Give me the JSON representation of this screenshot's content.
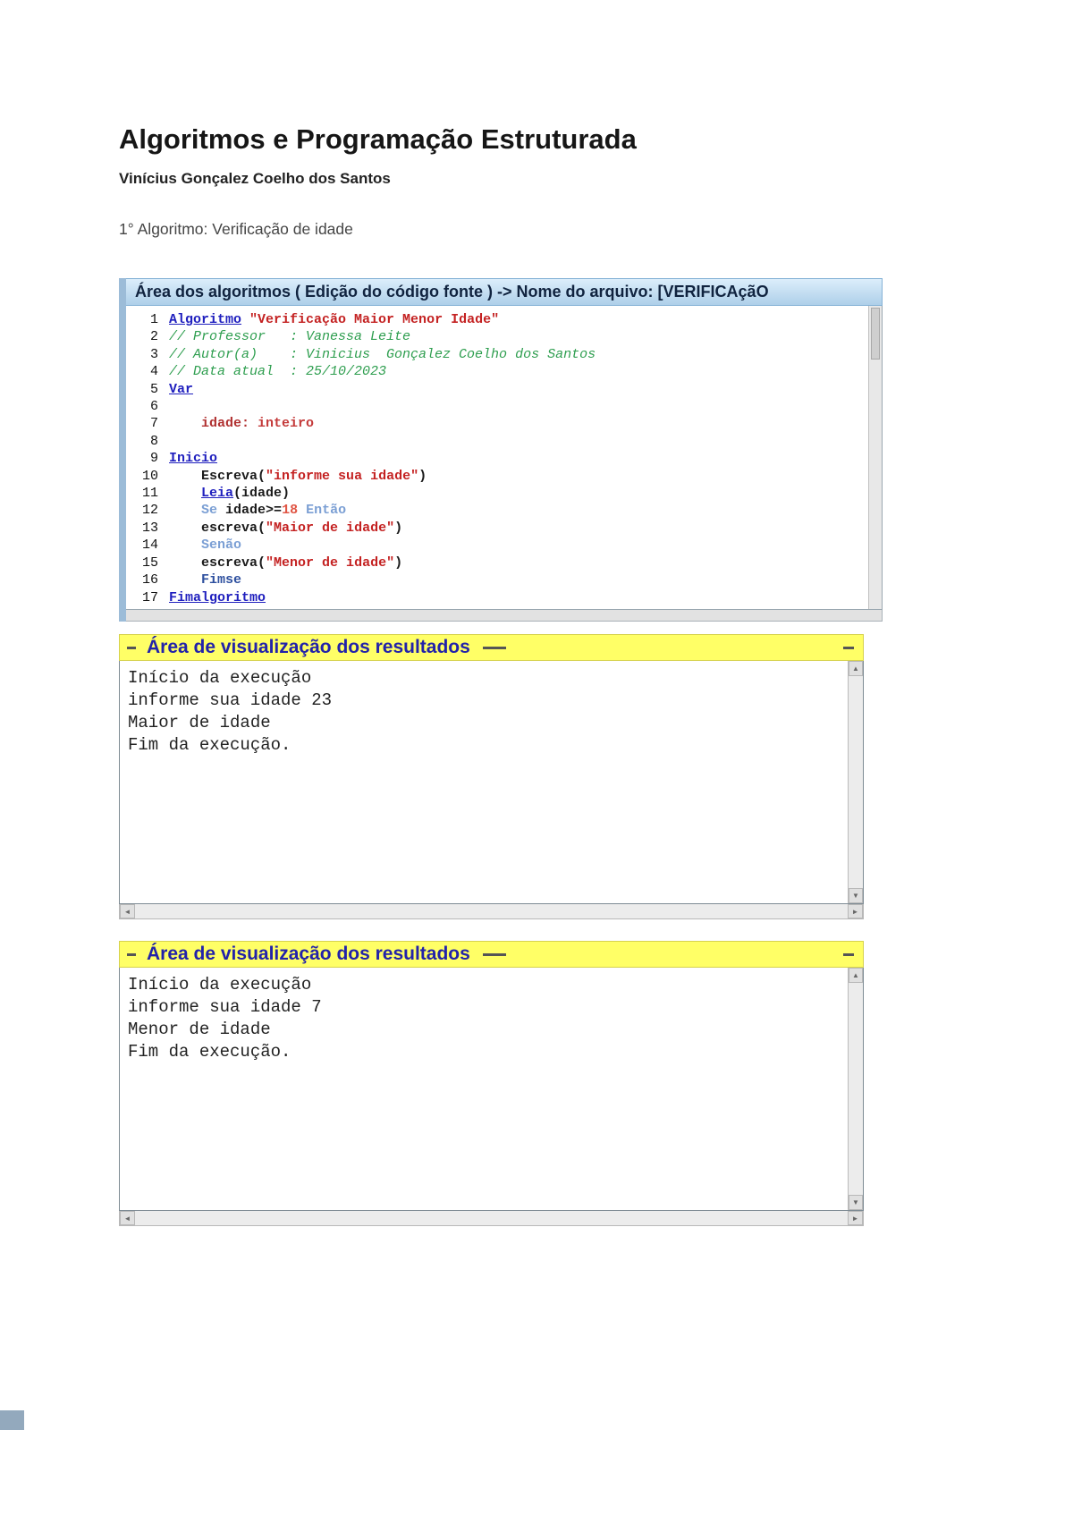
{
  "page": {
    "title": "Algoritmos e Programação Estruturada",
    "author": "Vinícius Gonçalez Coelho dos Santos",
    "section": "1° Algoritmo: Verificação de idade"
  },
  "editor": {
    "header": "Área dos algoritmos ( Edição do código fonte ) -> Nome do arquivo: [VERIFICAçãO",
    "lines": [
      {
        "n": "1",
        "s": [
          {
            "t": "Algoritmo",
            "c": "kw"
          },
          {
            "t": " ",
            "c": "pl"
          },
          {
            "t": "\"Verificação Maior Menor Idade\"",
            "c": "str"
          }
        ]
      },
      {
        "n": "2",
        "s": [
          {
            "t": "// Professor   : Vanessa Leite",
            "c": "com"
          }
        ]
      },
      {
        "n": "3",
        "s": [
          {
            "t": "// Autor(a)    : Vinicius  Gonçalez Coelho dos Santos",
            "c": "com"
          }
        ]
      },
      {
        "n": "4",
        "s": [
          {
            "t": "// Data atual  : 25/10/2023",
            "c": "com"
          }
        ]
      },
      {
        "n": "5",
        "s": [
          {
            "t": "Var",
            "c": "kw"
          }
        ]
      },
      {
        "n": "6",
        "s": []
      },
      {
        "n": "7",
        "s": [
          {
            "t": "    ",
            "c": "pl"
          },
          {
            "t": "idade:",
            "c": "decl"
          },
          {
            "t": " ",
            "c": "pl"
          },
          {
            "t": "inteiro",
            "c": "type"
          }
        ]
      },
      {
        "n": "8",
        "s": []
      },
      {
        "n": "9",
        "s": [
          {
            "t": "Inicio",
            "c": "kw"
          }
        ]
      },
      {
        "n": "10",
        "s": [
          {
            "t": "    ",
            "c": "pl"
          },
          {
            "t": "Escreva",
            "c": "id"
          },
          {
            "t": "(",
            "c": "pl"
          },
          {
            "t": "\"informe sua idade\"",
            "c": "str"
          },
          {
            "t": ")",
            "c": "pl"
          }
        ]
      },
      {
        "n": "11",
        "s": [
          {
            "t": "    ",
            "c": "pl"
          },
          {
            "t": "Leia",
            "c": "kw"
          },
          {
            "t": "(idade)",
            "c": "id"
          }
        ]
      },
      {
        "n": "12",
        "s": [
          {
            "t": "    ",
            "c": "pl"
          },
          {
            "t": "Se",
            "c": "kw2"
          },
          {
            "t": " ",
            "c": "pl"
          },
          {
            "t": "idade>=",
            "c": "id"
          },
          {
            "t": "18",
            "c": "num"
          },
          {
            "t": " ",
            "c": "pl"
          },
          {
            "t": "Então",
            "c": "kw2"
          }
        ]
      },
      {
        "n": "13",
        "s": [
          {
            "t": "    ",
            "c": "pl"
          },
          {
            "t": "escreva",
            "c": "id"
          },
          {
            "t": "(",
            "c": "pl"
          },
          {
            "t": "\"Maior de idade\"",
            "c": "str"
          },
          {
            "t": ")",
            "c": "pl"
          }
        ]
      },
      {
        "n": "14",
        "s": [
          {
            "t": "    ",
            "c": "pl"
          },
          {
            "t": "Senão",
            "c": "kw2"
          }
        ]
      },
      {
        "n": "15",
        "s": [
          {
            "t": "    ",
            "c": "pl"
          },
          {
            "t": "escreva",
            "c": "id"
          },
          {
            "t": "(",
            "c": "pl"
          },
          {
            "t": "\"Menor de idade\"",
            "c": "str"
          },
          {
            "t": ")",
            "c": "pl"
          }
        ]
      },
      {
        "n": "16",
        "s": [
          {
            "t": "    ",
            "c": "pl"
          },
          {
            "t": "Fimse",
            "c": "kwd"
          }
        ]
      },
      {
        "n": "17",
        "s": [
          {
            "t": "Fimalgoritmo",
            "c": "kw"
          }
        ]
      }
    ]
  },
  "results": [
    {
      "header": "Área de visualização dos resultados",
      "lines": [
        "Início da execução",
        "informe sua idade 23",
        "Maior de idade",
        "Fim da execução."
      ]
    },
    {
      "header": "Área de visualização dos resultados",
      "lines": [
        "Início da execução",
        "informe sua idade 7",
        "Menor de idade",
        "Fim da execução."
      ]
    }
  ],
  "icons": {
    "scroll_up": "▲",
    "scroll_down": "▼",
    "scroll_left": "◄",
    "scroll_right": "►"
  },
  "colors": {
    "keyword": "#1f1fbe",
    "string": "#c42222",
    "comment": "#2e9e4f",
    "results_header_bg": "#ffff66",
    "results_header_text": "#2222aa",
    "editor_header_bg": "#bcd8ef"
  }
}
